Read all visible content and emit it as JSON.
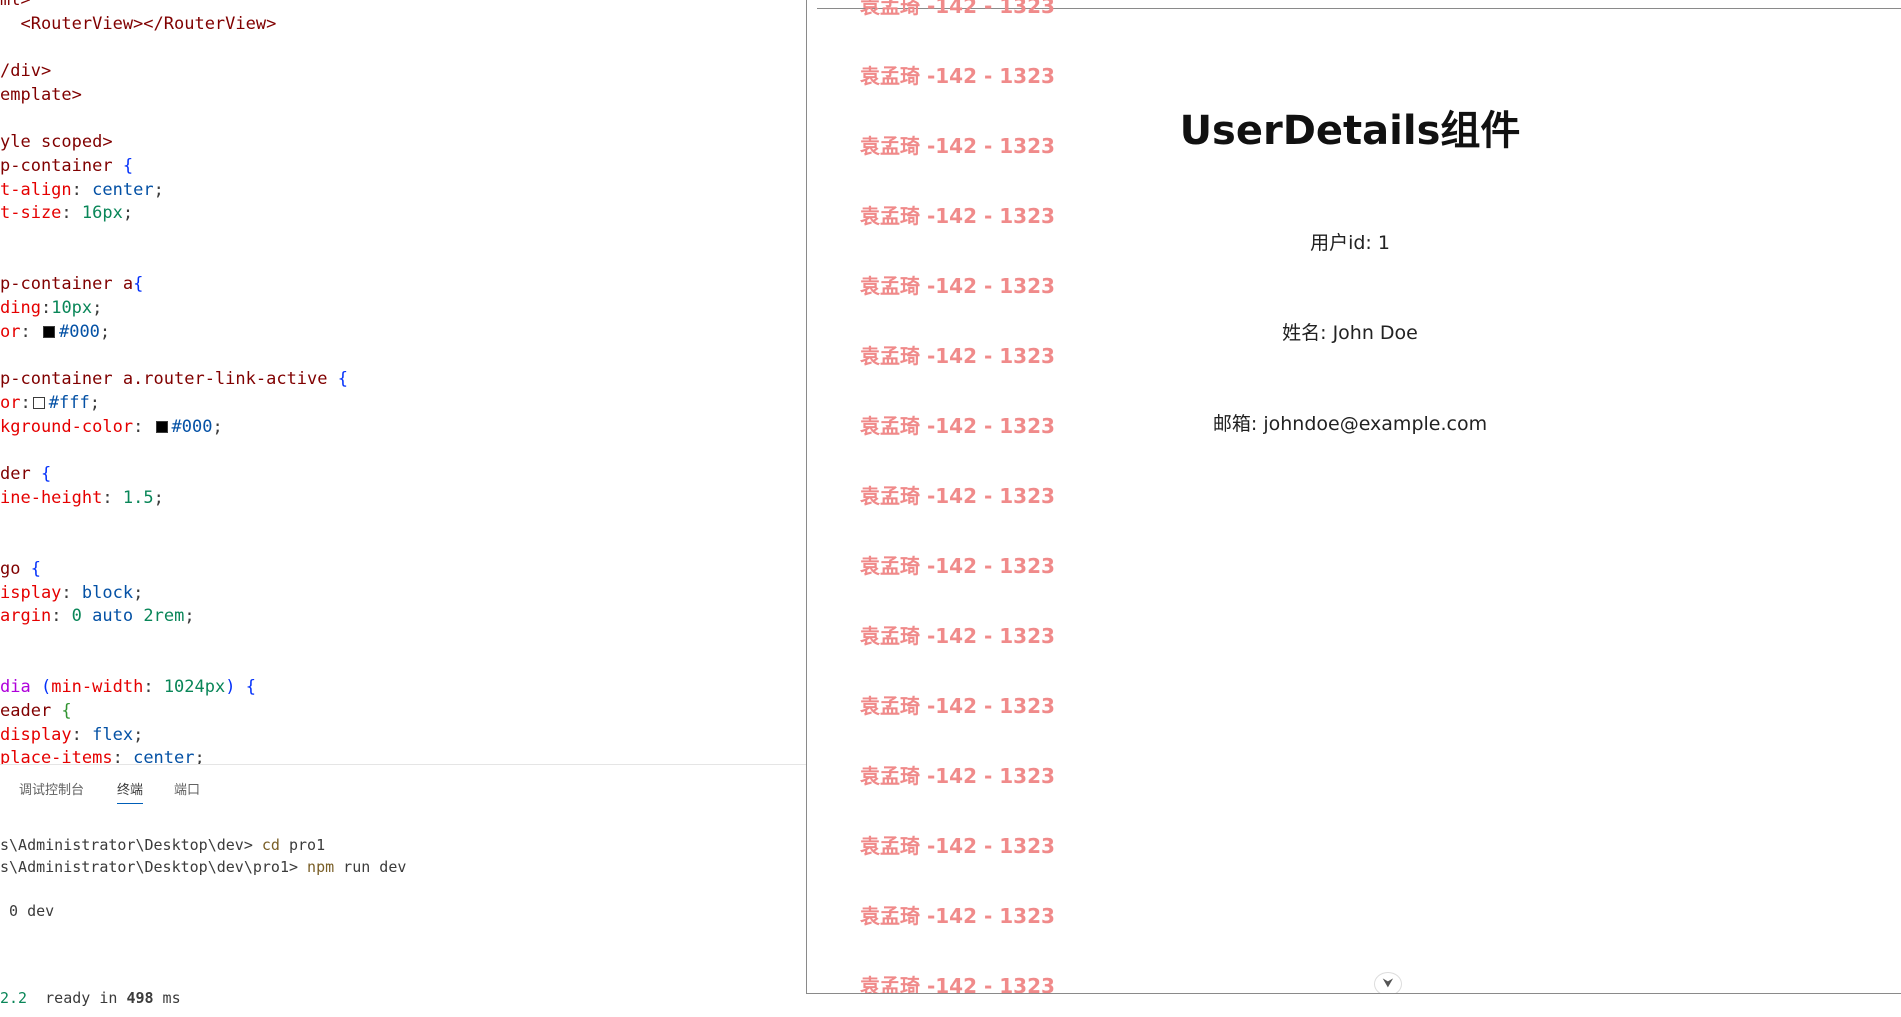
{
  "editor": {
    "lines": [
      [
        {
          "t": "ml>",
          "c": "tk-tag"
        }
      ],
      [
        {
          "t": "  <RouterView></RouterView>",
          "c": "tk-tag"
        }
      ],
      [],
      [
        {
          "t": "/div>",
          "c": "tk-tag"
        }
      ],
      [
        {
          "t": "emplate>",
          "c": "tk-tag"
        }
      ],
      [],
      [
        {
          "t": "yle scoped>",
          "c": "tk-tag"
        }
      ],
      [
        {
          "t": "p-container",
          "c": "tk-sel"
        },
        {
          "t": " {",
          "c": "tk-br"
        }
      ],
      [
        {
          "t": "t-align",
          "c": "tk-prop"
        },
        {
          "t": ": ",
          "c": "tk-p"
        },
        {
          "t": "center",
          "c": "tk-val"
        },
        {
          "t": ";",
          "c": "tk-p"
        }
      ],
      [
        {
          "t": "t-size",
          "c": "tk-prop"
        },
        {
          "t": ": ",
          "c": "tk-p"
        },
        {
          "t": "16px",
          "c": "tk-num"
        },
        {
          "t": ";",
          "c": "tk-p"
        }
      ],
      [],
      [],
      [
        {
          "t": "p-container a",
          "c": "tk-sel"
        },
        {
          "t": "{",
          "c": "tk-br"
        }
      ],
      [
        {
          "t": "ding",
          "c": "tk-prop"
        },
        {
          "t": ":",
          "c": "tk-p"
        },
        {
          "t": "10px",
          "c": "tk-num"
        },
        {
          "t": ";",
          "c": "tk-p"
        }
      ],
      [
        {
          "t": "or",
          "c": "tk-prop"
        },
        {
          "t": ": ",
          "c": "tk-p"
        },
        {
          "swatch": "#000000"
        },
        {
          "t": "#000",
          "c": "tk-val"
        },
        {
          "t": ";",
          "c": "tk-p"
        }
      ],
      [],
      [
        {
          "t": "p-container a.router-link-active",
          "c": "tk-sel"
        },
        {
          "t": " {",
          "c": "tk-br"
        }
      ],
      [
        {
          "t": "or",
          "c": "tk-prop"
        },
        {
          "t": ":",
          "c": "tk-p"
        },
        {
          "swatch": "#ffffff"
        },
        {
          "t": "#fff",
          "c": "tk-val"
        },
        {
          "t": ";",
          "c": "tk-p"
        }
      ],
      [
        {
          "t": "kground-color",
          "c": "tk-prop"
        },
        {
          "t": ": ",
          "c": "tk-p"
        },
        {
          "swatch": "#000000"
        },
        {
          "t": "#000",
          "c": "tk-val"
        },
        {
          "t": ";",
          "c": "tk-p"
        }
      ],
      [],
      [
        {
          "t": "der",
          "c": "tk-sel"
        },
        {
          "t": " {",
          "c": "tk-br"
        }
      ],
      [
        {
          "t": "ine-height",
          "c": "tk-prop"
        },
        {
          "t": ": ",
          "c": "tk-p"
        },
        {
          "t": "1.5",
          "c": "tk-num"
        },
        {
          "t": ";",
          "c": "tk-p"
        }
      ],
      [],
      [],
      [
        {
          "t": "go",
          "c": "tk-sel"
        },
        {
          "t": " {",
          "c": "tk-br"
        }
      ],
      [
        {
          "t": "isplay",
          "c": "tk-prop"
        },
        {
          "t": ": ",
          "c": "tk-p"
        },
        {
          "t": "block",
          "c": "tk-val"
        },
        {
          "t": ";",
          "c": "tk-p"
        }
      ],
      [
        {
          "t": "argin",
          "c": "tk-prop"
        },
        {
          "t": ": ",
          "c": "tk-p"
        },
        {
          "t": "0",
          "c": "tk-num"
        },
        {
          "t": " ",
          "c": "tk-p"
        },
        {
          "t": "auto",
          "c": "tk-val"
        },
        {
          "t": " ",
          "c": "tk-p"
        },
        {
          "t": "2rem",
          "c": "tk-num"
        },
        {
          "t": ";",
          "c": "tk-p"
        }
      ],
      [],
      [],
      [
        {
          "t": "dia",
          "c": "tk-at"
        },
        {
          "t": " (",
          "c": "tk-br"
        },
        {
          "t": "min-width",
          "c": "tk-prop"
        },
        {
          "t": ": ",
          "c": "tk-p"
        },
        {
          "t": "1024px",
          "c": "tk-num"
        },
        {
          "t": ")",
          "c": "tk-br"
        },
        {
          "t": " {",
          "c": "tk-br"
        }
      ],
      [
        {
          "t": "eader",
          "c": "tk-sel"
        },
        {
          "t": " {",
          "c": "tk-br2"
        }
      ],
      [
        {
          "t": "display",
          "c": "tk-prop"
        },
        {
          "t": ": ",
          "c": "tk-p"
        },
        {
          "t": "flex",
          "c": "tk-val"
        },
        {
          "t": ";",
          "c": "tk-p"
        }
      ],
      [
        {
          "t": "place-items",
          "c": "tk-prop"
        },
        {
          "t": ": ",
          "c": "tk-p"
        },
        {
          "t": "center",
          "c": "tk-val"
        },
        {
          "t": ";",
          "c": "tk-p"
        }
      ]
    ]
  },
  "panel": {
    "tabs": [
      {
        "label": "调试控制台",
        "active": false
      },
      {
        "label": "终端",
        "active": true
      },
      {
        "label": "端口",
        "active": false
      }
    ],
    "terminal": [
      [
        {
          "t": "s\\Administrator\\Desktop\\dev> ",
          "c": ""
        },
        {
          "t": "cd",
          "c": "term-cmd"
        },
        {
          "t": " pro1",
          "c": ""
        }
      ],
      [
        {
          "t": "s\\Administrator\\Desktop\\dev\\pro1> ",
          "c": ""
        },
        {
          "t": "npm",
          "c": "term-cmd"
        },
        {
          "t": " run dev",
          "c": ""
        }
      ],
      [],
      [
        {
          "t": " 0 dev",
          "c": ""
        }
      ],
      [],
      [],
      [],
      [
        {
          "t": "2.2",
          "c": "term-ver"
        },
        {
          "t": "  ready in ",
          "c": ""
        },
        {
          "t": "498",
          "c": "term-strong"
        },
        {
          "t": " ms",
          "c": ""
        }
      ]
    ]
  },
  "browser": {
    "watermark": "袁孟琦 -142 - 1323",
    "title": "UserDetails组件",
    "fields": [
      "用户id: 1",
      "姓名: John Doe",
      "邮箱: johndoe@example.com"
    ],
    "scroll_icon": "chevron-down-icon",
    "scroll_glyph": "⮟"
  },
  "colors": {
    "watermark": "#f08a8a",
    "accent": "#005fb8"
  }
}
